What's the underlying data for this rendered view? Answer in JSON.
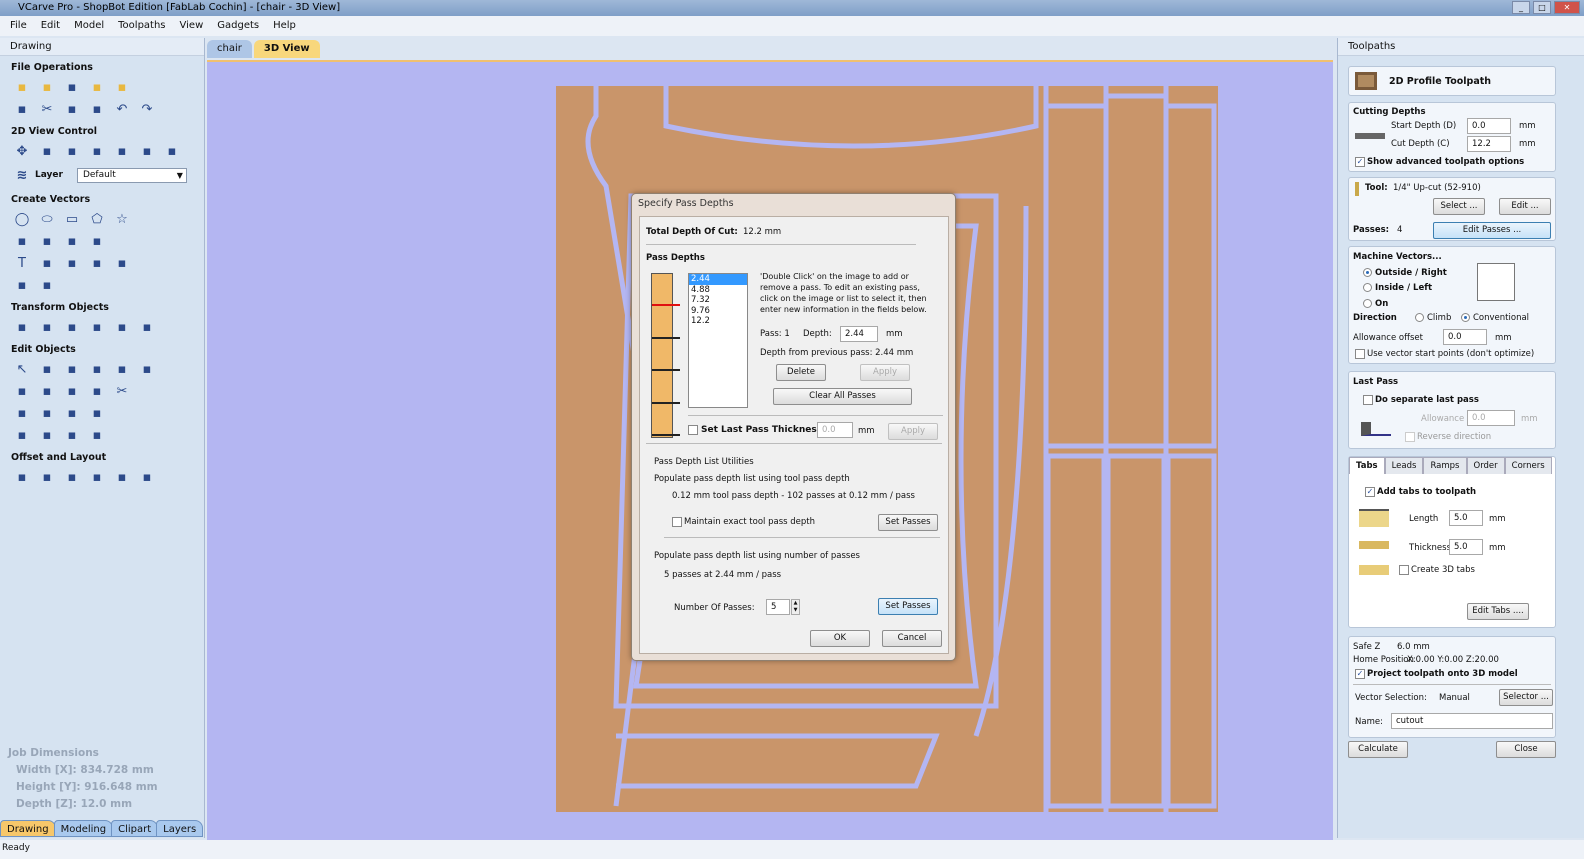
{
  "window": {
    "title": "VCarve Pro - ShopBot Edition [FabLab Cochin] - [chair - 3D View]",
    "controls": [
      "minimize",
      "maximize",
      "close"
    ]
  },
  "menu": [
    "File",
    "Edit",
    "Model",
    "Toolpaths",
    "View",
    "Gadgets",
    "Help"
  ],
  "left_panel": {
    "title": "Drawing",
    "sections": [
      {
        "title": "File Operations",
        "rows": [
          [
            "new-file-icon",
            "open-file-icon",
            "save-icon",
            "import-icon",
            "export-icon"
          ],
          [
            "select-all-icon",
            "cut-icon",
            "copy-icon",
            "paste-icon",
            "undo-icon",
            "redo-icon"
          ]
        ]
      },
      {
        "title": "2D View Control",
        "rows": [
          [
            "pan-icon",
            "zoom-box-icon",
            "zoom-all-icon",
            "zoom-selection-icon",
            "split-view-icon",
            "layout-icon",
            "window-icon"
          ]
        ]
      },
      {
        "title": "Create Vectors",
        "rows": [
          [
            "circle-icon",
            "ellipse-icon",
            "rectangle-icon",
            "polygon-icon",
            "star-icon"
          ],
          [
            "polyline-icon",
            "arc-icon",
            "curve-icon",
            "spiral-icon"
          ],
          [
            "text-icon",
            "text-box-icon",
            "text-on-curve-icon",
            "text-autolayout-icon",
            "text-arc-icon"
          ],
          [
            "dimension-icon",
            "measure-icon"
          ]
        ]
      },
      {
        "title": "Transform Objects",
        "rows": [
          [
            "move-icon",
            "scale-icon",
            "rotate-icon",
            "mirror-icon",
            "distort-icon",
            "align-icon"
          ]
        ]
      },
      {
        "title": "Edit Objects",
        "rows": [
          [
            "select-icon",
            "node-edit-icon",
            "interactive-select-icon",
            "group-icon",
            "ungroup-icon",
            "trim-icon"
          ],
          [
            "weld-icon",
            "subtract-icon",
            "intersect-icon",
            "fillet-icon",
            "scissors-icon"
          ],
          [
            "smooth-icon",
            "node-icon",
            "join-icon",
            "close-vector-icon"
          ],
          [
            "offset-icon",
            "extend-icon",
            "bridge-icon",
            "cut-vector-icon"
          ]
        ]
      },
      {
        "title": "Offset and Layout",
        "rows": [
          [
            "offset-vector-icon",
            "array-icon",
            "nest-icon",
            "copy-along-icon",
            "grid-array-icon",
            "block-icon"
          ]
        ]
      }
    ],
    "layer_label": "Layer",
    "layer_value": "Default",
    "job_dimensions": {
      "title": "Job Dimensions",
      "width": "Width  [X]: 834.728 mm",
      "height": "Height [Y]: 916.648 mm",
      "depth": "Depth  [Z]: 12.0 mm"
    },
    "tabs": [
      "Drawing",
      "Modeling",
      "Clipart",
      "Layers"
    ]
  },
  "doc_tabs": [
    "chair",
    "3D View"
  ],
  "status": "Ready",
  "dialog": {
    "title": "Specify Pass Depths",
    "total_label": "Total Depth Of Cut:",
    "total_value": "12.2 mm",
    "pass_depths_label": "Pass Depths",
    "passes": [
      "2.44",
      "4.88",
      "7.32",
      "9.76",
      "12.2"
    ],
    "help": "'Double Click' on the image to add or remove a pass. To edit an existing pass, click on the image or list to select it, then enter new information in the fields below.",
    "pass_label": "Pass: 1",
    "depth_label": "Depth:",
    "depth_value": "2.44",
    "unit": "mm",
    "prev_label": "Depth from previous pass:  2.44 mm",
    "delete": "Delete",
    "apply": "Apply",
    "clear": "Clear All Passes",
    "last_pass_label": "Set Last Pass Thickness",
    "last_pass_value": "0.0",
    "util_title": "Pass Depth List Utilities",
    "tool_depth_title": "Populate pass depth list using tool pass depth",
    "tool_depth_info": "0.12 mm tool pass depth - 102 passes at 0.12 mm / pass",
    "maintain_label": "Maintain exact tool pass depth",
    "set_passes": "Set Passes",
    "num_title": "Populate pass depth list using number of passes",
    "num_info": "5 passes at 2.44 mm / pass",
    "num_label": "Number Of Passes:",
    "num_value": "5",
    "ok": "OK",
    "cancel": "Cancel"
  },
  "right_panel": {
    "title": "Toolpaths",
    "header": "2D Profile Toolpath",
    "cutting": {
      "title": "Cutting Depths",
      "start_label": "Start Depth (D)",
      "start": "0.0",
      "cut_label": "Cut Depth (C)",
      "cut": "12.2",
      "unit": "mm",
      "advanced": "Show advanced toolpath options"
    },
    "tool": {
      "label": "Tool:",
      "value": "1/4\" Up-cut (52-910)",
      "select": "Select ...",
      "edit": "Edit ...",
      "passes_label": "Passes:",
      "passes": "4",
      "edit_passes": "Edit Passes ..."
    },
    "machine": {
      "title": "Machine Vectors...",
      "outside": "Outside / Right",
      "inside": "Inside / Left",
      "on": "On",
      "direction": "Direction",
      "climb": "Climb",
      "conventional": "Conventional",
      "allowance_label": "Allowance offset",
      "allowance": "0.0",
      "use_start": "Use vector start points (don't optimize)"
    },
    "last_pass": {
      "title": "Last Pass",
      "separate": "Do separate last pass",
      "allowance_label": "Allowance (A)",
      "allowance": "0.0",
      "reverse": "Reverse direction"
    },
    "tabs": [
      "Tabs",
      "Leads",
      "Ramps",
      "Order",
      "Corners"
    ],
    "tabs_panel": {
      "add": "Add tabs to toolpath",
      "length_label": "Length",
      "length": "5.0",
      "thickness_label": "Thickness",
      "thickness": "5.0",
      "create3d": "Create 3D tabs",
      "edit_tabs": "Edit Tabs ...."
    },
    "safe_z_label": "Safe Z",
    "safe_z": "6.0 mm",
    "home_label": "Home Position",
    "home": "X:0.00 Y:0.00 Z:20.00",
    "project": "Project toolpath onto 3D model",
    "vector_sel_label": "Vector Selection:",
    "vector_sel": "Manual",
    "selector": "Selector ...",
    "name_label": "Name:",
    "name": "cutout",
    "calculate": "Calculate",
    "close": "Close"
  },
  "colors": {
    "wood": "#c9956a",
    "background": "#b4b6f2",
    "accent": "#f7c76a"
  }
}
